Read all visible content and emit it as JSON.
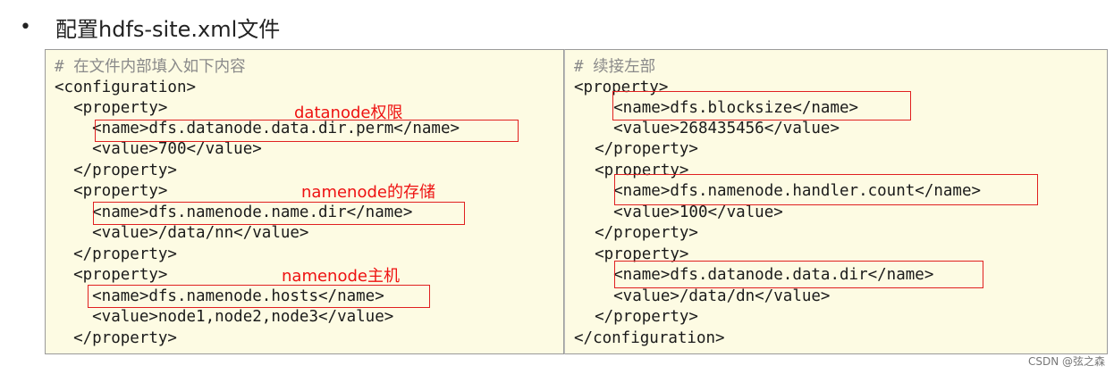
{
  "heading": {
    "bullet": "•",
    "title": "配置hdfs-site.xml文件"
  },
  "left_panel": {
    "lines": [
      "# 在文件内部填入如下内容",
      "<configuration>",
      "  <property>",
      "    <name>dfs.datanode.data.dir.perm</name>",
      "    <value>700</value>",
      "  </property>",
      "  <property>",
      "    <name>dfs.namenode.name.dir</name>",
      "    <value>/data/nn</value>",
      "  </property>",
      "  <property>",
      "    <name>dfs.namenode.hosts</name>",
      "    <value>node1,node2,node3</value>",
      "  </property>"
    ],
    "annotations": [
      "datanode权限",
      "namenode的存储",
      "namenode主机"
    ]
  },
  "right_panel": {
    "lines": [
      "# 续接左部",
      "<property>",
      "    <name>dfs.blocksize</name>",
      "    <value>268435456</value>",
      "  </property>",
      "  <property>",
      "    <name>dfs.namenode.handler.count</name>",
      "    <value>100</value>",
      "  </property>",
      "  <property>",
      "    <name>dfs.datanode.data.dir</name>",
      "    <value>/data/dn</value>",
      "  </property>",
      "</configuration>"
    ]
  },
  "watermark": "CSDN @弦之森",
  "colors": {
    "panel_background": "#fdfbe3",
    "highlight": "#e02020",
    "annotation_text": "#ee1111",
    "comment": "#8a8a8a"
  }
}
